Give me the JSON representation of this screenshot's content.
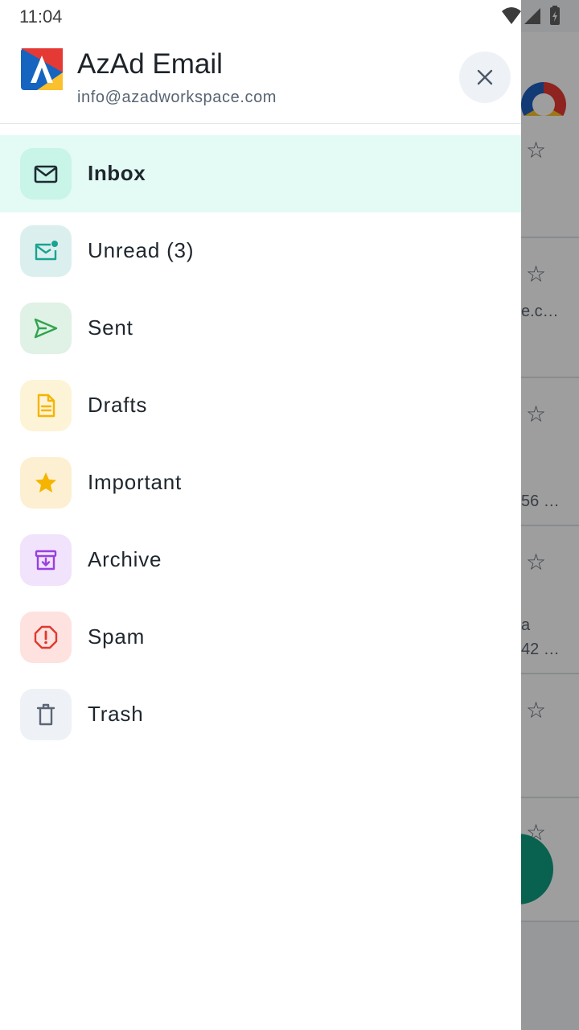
{
  "status_bar": {
    "time": "11:04"
  },
  "drawer": {
    "app_name": "AzAd Email",
    "account_email": "info@azadworkspace.com",
    "close_icon": "close-icon",
    "logo_colors": [
      "#1565c0",
      "#e53935",
      "#fbc02d"
    ],
    "menu": [
      {
        "label": "Inbox",
        "icon": "mail-icon",
        "icon_color": "#1f2933",
        "icon_bg": "#c8f5e8",
        "active": true
      },
      {
        "label": "Unread (3)",
        "icon": "mail-unread-icon",
        "icon_color": "#1aa391",
        "icon_bg": "#dbf0ee",
        "active": false
      },
      {
        "label": "Sent",
        "icon": "send-icon",
        "icon_color": "#2fa44f",
        "icon_bg": "#e0f1e5",
        "active": false
      },
      {
        "label": "Drafts",
        "icon": "document-icon",
        "icon_color": "#f5b400",
        "icon_bg": "#fdf3d6",
        "active": false
      },
      {
        "label": "Important",
        "icon": "star-icon",
        "icon_color": "#f5b400",
        "icon_bg": "#fdf0d2",
        "active": false
      },
      {
        "label": "Archive",
        "icon": "archive-icon",
        "icon_color": "#9a3fe0",
        "icon_bg": "#f1e3fb",
        "active": false
      },
      {
        "label": "Spam",
        "icon": "spam-icon",
        "icon_color": "#e0382e",
        "icon_bg": "#fde2e0",
        "active": false
      },
      {
        "label": "Trash",
        "icon": "trash-icon",
        "icon_color": "#5b6675",
        "icon_bg": "#eef1f5",
        "active": false
      }
    ]
  },
  "background": {
    "snippets": [
      "e.c…",
      "56 …",
      "a",
      "42 …"
    ],
    "fab_color": "#0f9d80"
  }
}
